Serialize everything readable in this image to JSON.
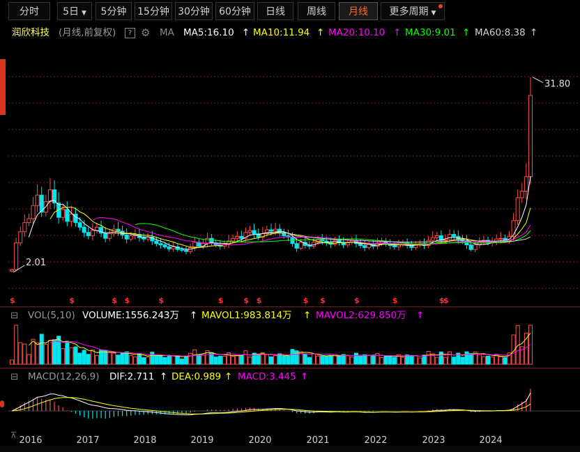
{
  "tabs": [
    {
      "label": "分时",
      "active": false
    },
    {
      "label": "5日",
      "active": false,
      "dropdown": true
    },
    {
      "label": "5分钟",
      "active": false
    },
    {
      "label": "15分钟",
      "active": false
    },
    {
      "label": "30分钟",
      "active": false
    },
    {
      "label": "60分钟",
      "active": false
    },
    {
      "label": "日线",
      "active": false
    },
    {
      "label": "周线",
      "active": false
    },
    {
      "label": "月线",
      "active": true
    },
    {
      "label": "更多周期",
      "active": false,
      "dropdown": true
    }
  ],
  "info": {
    "stock_name": "润欣科技",
    "mode": "(月线,前复权)",
    "help": "?",
    "ma_label": "MA",
    "ma5": "MA5:16.10",
    "ma10": "MA10:11.94",
    "ma20": "MA20:10.10",
    "ma30": "MA30:9.01",
    "ma60": "MA60:8.38"
  },
  "colors": {
    "up": "#ff4e4e",
    "down": "#00e5ee",
    "ma5": "#ffffff",
    "ma10": "#ffff00",
    "ma20": "#ff00ff",
    "ma30": "#00ff00",
    "ma60": "#d0d0d0",
    "grid": "#8a1c1c",
    "bg": "#000000"
  },
  "vol_panel": {
    "title": "VOL(5,10)",
    "volume": "VOLUME:1556.243万",
    "mavol1": "MAVOL1:983.814万",
    "mavol2": "MAVOL2:629.850万"
  },
  "macd_panel": {
    "title": "MACD(12,26,9)",
    "dif": "DIF:2.711",
    "dea": "DEA:0.989",
    "macd": "MACD:3.445"
  },
  "annotations": {
    "high": "31.80",
    "low": "2.01"
  },
  "chart_data": {
    "type": "candlestick",
    "period": "monthly",
    "years": [
      "2016",
      "2017",
      "2018",
      "2019",
      "2020",
      "2021",
      "2022",
      "2023",
      "2024"
    ],
    "high": 31.8,
    "low": 2.01,
    "ylim": [
      0,
      34
    ],
    "series_note": "monthly OHLC approximated",
    "close": [
      2.4,
      6.5,
      8.2,
      9.6,
      10.2,
      12.2,
      13.8,
      11.2,
      12.8,
      14.6,
      12.6,
      10.4,
      11.6,
      9.8,
      10.9,
      9.6,
      8.9,
      8.1,
      7.6,
      8.4,
      8.9,
      8.0,
      7.2,
      7.9,
      8.6,
      8.3,
      7.7,
      7.1,
      7.6,
      7.8,
      7.3,
      7.1,
      7.4,
      6.8,
      6.4,
      6.2,
      5.9,
      5.6,
      5.9,
      5.5,
      5.4,
      5.2,
      5.8,
      6.6,
      6.0,
      6.4,
      7.2,
      6.5,
      6.2,
      6.0,
      6.3,
      6.8,
      7.2,
      7.5,
      7.2,
      8.1,
      8.4,
      7.9,
      7.4,
      7.9,
      8.5,
      8.3,
      8.6,
      8.0,
      7.6,
      7.4,
      6.4,
      5.7,
      6.6,
      6.1,
      6.0,
      6.6,
      7.0,
      6.8,
      6.5,
      6.3,
      6.9,
      6.6,
      6.2,
      6.6,
      6.9,
      6.4,
      6.1,
      5.8,
      6.3,
      6.0,
      6.5,
      6.7,
      6.3,
      6.1,
      5.9,
      6.2,
      6.5,
      6.1,
      5.8,
      6.2,
      6.4,
      6.1,
      6.9,
      7.3,
      7.6,
      6.9,
      7.0,
      7.8,
      7.5,
      7.0,
      6.8,
      6.2,
      5.5,
      6.2,
      6.6,
      6.9,
      6.5,
      6.6,
      7.1,
      7.2,
      6.9,
      7.5,
      9.9,
      13.4,
      14.4,
      16.6,
      29.0
    ]
  }
}
